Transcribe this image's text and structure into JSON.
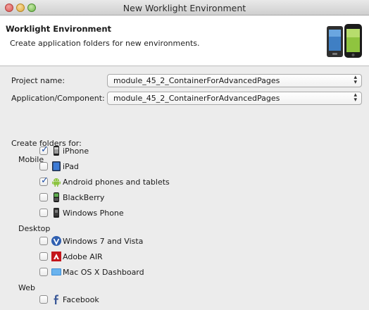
{
  "window": {
    "title": "New Worklight Environment"
  },
  "header": {
    "title": "Worklight Environment",
    "description": "Create application folders for new environments."
  },
  "form": {
    "project_label": "Project name:",
    "project_value": "module_45_2_ContainerForAdvancedPages",
    "app_label": "Application/Component:",
    "app_value": "module_45_2_ContainerForAdvancedPages"
  },
  "folders": {
    "label": "Create folders for:",
    "groups": [
      {
        "name": "Mobile",
        "items": [
          {
            "label": "iPhone",
            "checked": true,
            "icon": "iphone-icon"
          },
          {
            "label": "iPad",
            "checked": false,
            "icon": "ipad-icon"
          },
          {
            "label": "Android phones and tablets",
            "checked": true,
            "icon": "android-icon"
          },
          {
            "label": "BlackBerry",
            "checked": false,
            "icon": "blackberry-icon"
          },
          {
            "label": "Windows Phone",
            "checked": false,
            "icon": "windows-phone-icon"
          }
        ]
      },
      {
        "name": "Desktop",
        "items": [
          {
            "label": "Windows 7 and Vista",
            "checked": false,
            "icon": "windows-icon"
          },
          {
            "label": "Adobe AIR",
            "checked": false,
            "icon": "adobe-air-icon"
          },
          {
            "label": "Mac OS X Dashboard",
            "checked": false,
            "icon": "dashboard-icon"
          }
        ]
      },
      {
        "name": "Web",
        "items": [
          {
            "label": "Facebook",
            "checked": false,
            "icon": "facebook-icon"
          }
        ]
      }
    ]
  },
  "colors": {
    "accent": "#1c4fa8",
    "header_bg": "#ffffff",
    "window_bg": "#ececec"
  }
}
